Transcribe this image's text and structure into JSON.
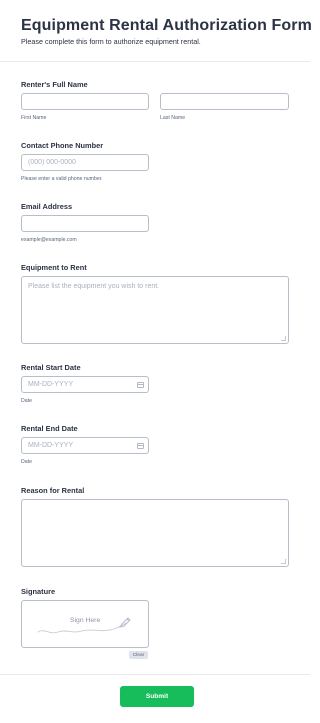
{
  "form": {
    "title": "Equipment Rental Authorization Form",
    "subtitle": "Please complete this form to authorize equipment rental."
  },
  "fields": {
    "full_name": {
      "label": "Renter's Full Name",
      "first_value": "",
      "last_value": "",
      "first_sublabel": "First Name",
      "last_sublabel": "Last Name"
    },
    "phone": {
      "label": "Contact Phone Number",
      "placeholder": "(000) 000-0000",
      "value": "",
      "sublabel": "Please enter a valid phone number."
    },
    "email": {
      "label": "Email Address",
      "value": "",
      "sublabel": "example@example.com"
    },
    "equipment": {
      "label": "Equipment to Rent",
      "placeholder": "Please list the equipment you wish to rent.",
      "value": ""
    },
    "start_date": {
      "label": "Rental Start Date",
      "placeholder": "MM-DD-YYYY",
      "value": "",
      "sublabel": "Date",
      "icon": "calendar-icon"
    },
    "end_date": {
      "label": "Rental End Date",
      "placeholder": "MM-DD-YYYY",
      "value": "",
      "sublabel": "Date",
      "icon": "calendar-icon"
    },
    "reason": {
      "label": "Reason for Rental",
      "placeholder": "",
      "value": ""
    },
    "signature": {
      "label": "Signature",
      "hint": "Sign Here",
      "clear_label": "Clear",
      "icon": "pen-icon"
    }
  },
  "actions": {
    "submit_label": "Submit",
    "submit_color": "#18bd5b"
  }
}
